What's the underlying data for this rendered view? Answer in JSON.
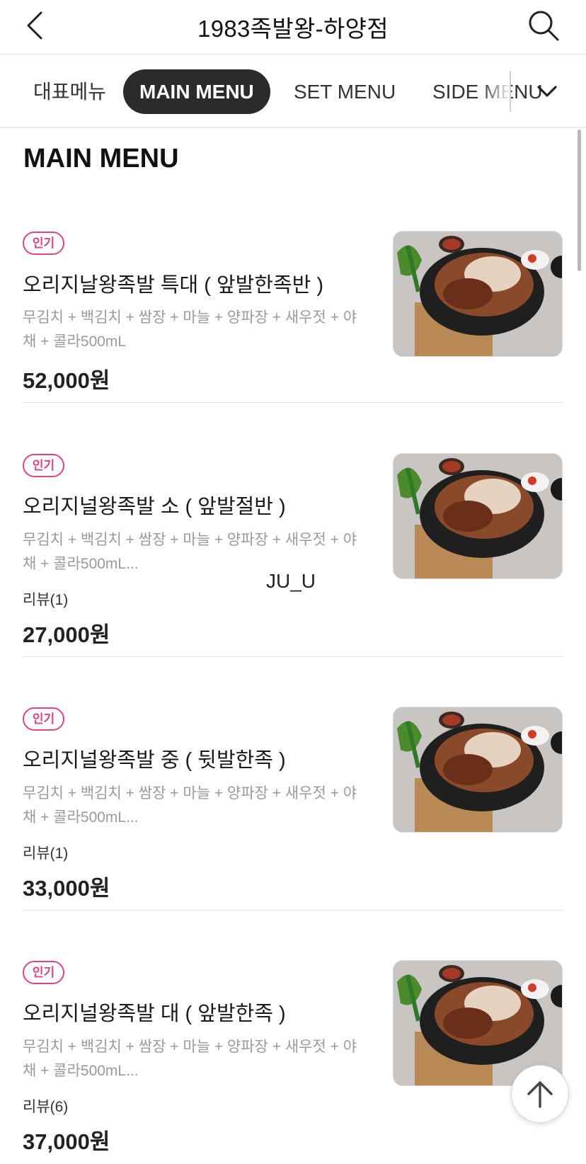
{
  "header": {
    "title": "1983족발왕-하양점",
    "back_icon": "chevron-left-icon",
    "search_icon": "search-icon"
  },
  "tabs": [
    {
      "label": "대표메뉴",
      "active": false
    },
    {
      "label": "MAIN MENU",
      "active": true
    },
    {
      "label": "SET MENU",
      "active": false
    },
    {
      "label": "SIDE MENU",
      "active": false
    }
  ],
  "tab_dropdown_icon": "chevron-down-icon",
  "section": {
    "title": "MAIN MENU"
  },
  "items": [
    {
      "badge": "인기",
      "name": "오리지날왕족발 특대 ( 앞발한족반 )",
      "desc": "무김치 + 백김치 + 쌈장 + 마늘 + 양파장 + 새우젓 + 야채 + 콜라500mL",
      "review": "",
      "price": "52,000원"
    },
    {
      "badge": "인기",
      "name": "오리지널왕족발 소 ( 앞발절반 )",
      "desc": "무김치 + 백김치 + 쌈장 + 마늘 + 양파장 + 새우젓 + 야채 + 콜라500mL...",
      "review": "리뷰(1)",
      "price": "27,000원"
    },
    {
      "badge": "인기",
      "name": "오리지널왕족발 중 ( 뒷발한족 )",
      "desc": "무김치 + 백김치 + 쌈장 + 마늘 + 양파장 + 새우젓 + 야채 + 콜라500mL...",
      "review": "리뷰(1)",
      "price": "33,000원"
    },
    {
      "badge": "인기",
      "name": "오리지널왕족발 대 ( 앞발한족 )",
      "desc": "무김치 + 백김치 + 쌈장 + 마늘 + 양파장 + 새우젓 + 야채 + 콜라500mL...",
      "review": "리뷰(6)",
      "price": "37,000원"
    }
  ],
  "watermark": "JU_U",
  "scroll_top_icon": "arrow-up-icon",
  "colors": {
    "accent_pink": "#e0447e",
    "active_tab_bg": "#2b2b2b",
    "desc_gray": "#9a9a9a"
  }
}
